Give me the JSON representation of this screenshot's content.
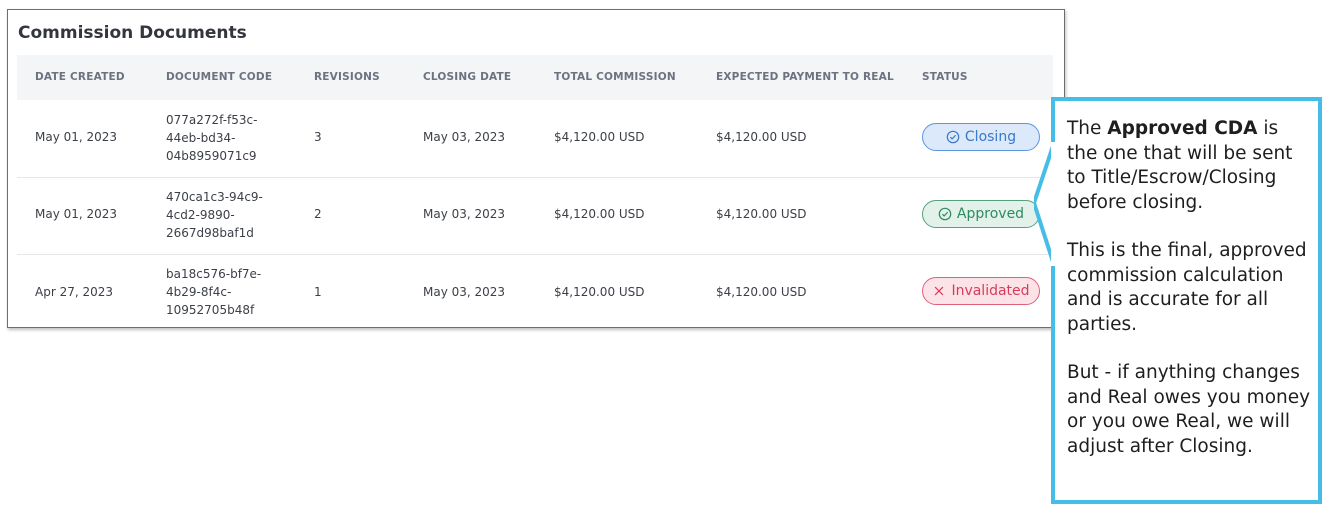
{
  "panel": {
    "title": "Commission Documents",
    "columns": [
      "DATE CREATED",
      "DOCUMENT CODE",
      "REVISIONS",
      "CLOSING DATE",
      "TOTAL COMMISSION",
      "EXPECTED PAYMENT TO REAL",
      "STATUS"
    ],
    "rows": [
      {
        "date_created": "May 01, 2023",
        "code_lines": [
          "077a272f-f53c-",
          "44eb-bd34-",
          "04b8959071c9"
        ],
        "revisions": "3",
        "closing_date": "May 03, 2023",
        "total_commission": "$4,120.00 USD",
        "expected_payment": "$4,120.00 USD",
        "status": "Closing",
        "status_icon": "check-circle-icon"
      },
      {
        "date_created": "May 01, 2023",
        "code_lines": [
          "470ca1c3-94c9-",
          "4cd2-9890-",
          "2667d98baf1d"
        ],
        "revisions": "2",
        "closing_date": "May 03, 2023",
        "total_commission": "$4,120.00 USD",
        "expected_payment": "$4,120.00 USD",
        "status": "Approved",
        "status_icon": "check-circle-icon"
      },
      {
        "date_created": "Apr 27, 2023",
        "code_lines": [
          "ba18c576-bf7e-",
          "4b29-8f4c-",
          "10952705b48f"
        ],
        "revisions": "1",
        "closing_date": "May 03, 2023",
        "total_commission": "$4,120.00 USD",
        "expected_payment": "$4,120.00 USD",
        "status": "Invalidated",
        "status_icon": "x-icon"
      }
    ]
  },
  "callout": {
    "p1_prefix": "The ",
    "p1_bold": "Approved CDA",
    "p1_suffix": " is the one that will be sent to Title/Escrow/Closing before closing.",
    "p2": "This is the final, approved commission calculation and is accurate for all parties.",
    "p3": "But - if anything changes and Real owes you money or you owe Real, we will adjust after Closing."
  },
  "colors": {
    "callout_border": "#46bde6",
    "closing": "#3a78c9",
    "approved": "#2e8a60",
    "invalidated": "#d93a5c"
  }
}
